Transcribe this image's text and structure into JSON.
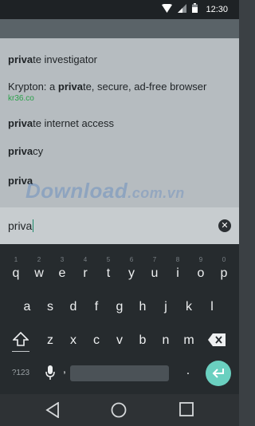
{
  "status_bar": {
    "time": "12:30"
  },
  "suggestions": [
    {
      "bold": "priva",
      "rest": "te investigator",
      "prefix": "",
      "sub": ""
    },
    {
      "prefix": "Krypton: a ",
      "bold": "priva",
      "rest": "te, secure, ad-free browser",
      "sub": "kr36.co"
    },
    {
      "bold": "priva",
      "rest": "te internet access",
      "prefix": "",
      "sub": ""
    },
    {
      "bold": "priva",
      "rest": "cy",
      "prefix": "",
      "sub": ""
    },
    {
      "bold": "priva",
      "rest": "",
      "prefix": "",
      "sub": ""
    }
  ],
  "watermark": {
    "name": "Download",
    "tld": ".com.vn"
  },
  "watermark_colors": [
    "#5aa0e0",
    "#b4b4b4",
    "#7bc142",
    "#f0a030",
    "#3a80d0",
    "#e04040"
  ],
  "search": {
    "value": "priva"
  },
  "keyboard": {
    "row1": [
      "q",
      "w",
      "e",
      "r",
      "t",
      "y",
      "u",
      "i",
      "o",
      "p"
    ],
    "row1_hints": [
      "1",
      "2",
      "3",
      "4",
      "5",
      "6",
      "7",
      "8",
      "9",
      "0"
    ],
    "row2": [
      "a",
      "s",
      "d",
      "f",
      "g",
      "h",
      "j",
      "k",
      "l"
    ],
    "row3": [
      "z",
      "x",
      "c",
      "v",
      "b",
      "n",
      "m"
    ],
    "symbols_label": "?123",
    "comma": ",",
    "period": "."
  },
  "colors": {
    "accent": "#6ad0c0",
    "link_green": "#2aa14a"
  }
}
